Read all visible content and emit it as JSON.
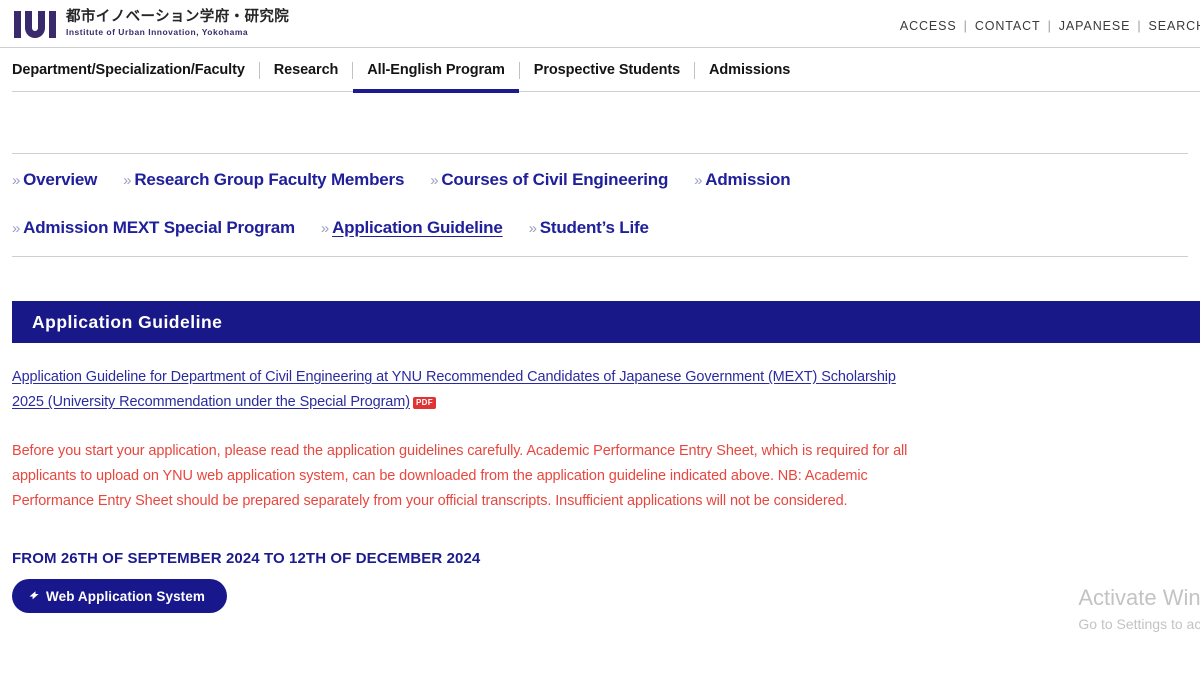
{
  "header": {
    "logo_mark": "IUI",
    "logo_jp": "都市イノベーション学府・研究院",
    "logo_en": "Institute of Urban Innovation, Yokohama",
    "util_nav": [
      {
        "label": "ACCESS"
      },
      {
        "label": "CONTACT"
      },
      {
        "label": "JAPANESE"
      },
      {
        "label": "SEARCH"
      }
    ],
    "util_separator": "|"
  },
  "main_nav": {
    "items": [
      {
        "label": "Department/Specialization/Faculty",
        "active": false
      },
      {
        "label": "Research",
        "active": false
      },
      {
        "label": "All-English Program",
        "active": true
      },
      {
        "label": "Prospective Students",
        "active": false
      },
      {
        "label": "Admissions",
        "active": false
      }
    ]
  },
  "subnav": {
    "chevron": "»",
    "row1": [
      {
        "label": "Overview",
        "current": false
      },
      {
        "label": "Research Group Faculty Members",
        "current": false
      },
      {
        "label": "Courses of Civil Engineering",
        "current": false
      },
      {
        "label": "Admission",
        "current": false
      }
    ],
    "row2": [
      {
        "label": "Admission MEXT Special Program",
        "current": false
      },
      {
        "label": "Application Guideline",
        "current": true
      },
      {
        "label": "Student’s Life",
        "current": false
      }
    ]
  },
  "main": {
    "banner_title": "Application Guideline",
    "document_link": "Application Guideline for Department of Civil Engineering at YNU Recommended Candidates of Japanese Government (MEXT) Scholarship 2025 (University Recommendation under the Special Program)",
    "document_badge": "PDF",
    "notice": "Before you start your application, please read the application guidelines carefully. Academic Performance Entry Sheet, which is required for all applicants to upload on YNU web application system, can be downloaded from the application guideline indicated above. NB: Academic Performance Entry Sheet should be prepared separately from your official transcripts. Insufficient applications will not be considered.",
    "period": "FROM 26TH OF SEPTEMBER 2024 TO 12TH OF DECEMBER 2024",
    "apply_button": "Web Application System"
  },
  "watermark": {
    "title": "Activate Windows",
    "subtitle": "Go to Settings to activate"
  },
  "colors": {
    "brand_navy": "#18188c",
    "banner_navy": "#181889",
    "link_blue": "#2b2ba0",
    "notice_red": "#e8473f",
    "pdf_badge_red": "#e03434",
    "logo_purple": "#3b2a6b"
  }
}
